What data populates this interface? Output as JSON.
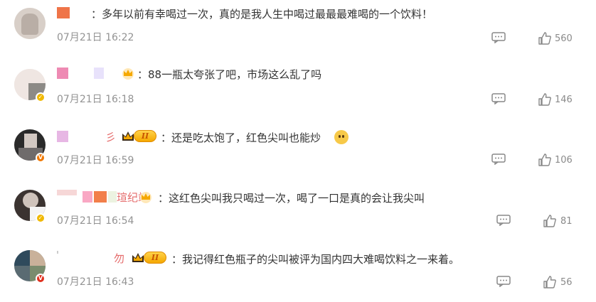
{
  "comments": [
    {
      "text": "：多年以前有幸喝过一次，真的是我人生中喝过最最最难喝的一个饮料！",
      "time": "07月21日 16:22",
      "likes": "560",
      "badge": ""
    },
    {
      "text": "：88一瓶太夸张了吧，市场这么乱了吗",
      "time": "07月21日 16:18",
      "likes": "146",
      "badge": ""
    },
    {
      "text": "：还是吃太饱了，红色尖叫也能炒",
      "time": "07月21日 16:59",
      "likes": "106",
      "badge": "II"
    },
    {
      "text": "：这红色尖叫我只喝过一次，喝了一口是真的会让我尖叫",
      "time": "07月21日 16:54",
      "likes": "81",
      "badge": ""
    },
    {
      "text": "：我记得红色瓶子的尖叫被评为国内四大难喝饮料之一来着。",
      "time": "07月21日 16:43",
      "likes": "56",
      "badge": "II"
    }
  ],
  "partial_names": {
    "c3": "彡",
    "c4": "瑄纪站",
    "c5": "勿"
  },
  "colors": {
    "text": "#333333",
    "meta": "#939393",
    "crown": "#f5a800"
  },
  "icons": {
    "reply": "comment-icon",
    "like": "thumbs-up-icon",
    "emoji": "doge-emoji-icon"
  }
}
